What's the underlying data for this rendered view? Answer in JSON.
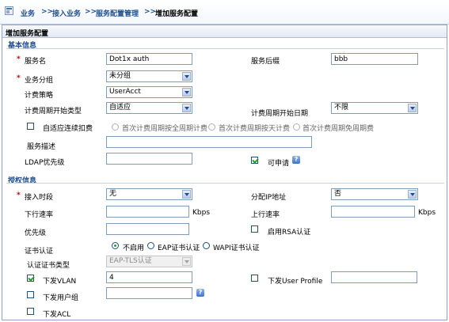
{
  "breadcrumb": {
    "items": [
      "业务",
      "接入业务",
      "服务配置管理",
      "增加服务配置"
    ],
    "separator": ">>"
  },
  "panel_title": "增加服务配置",
  "basic": {
    "title": "基本信息",
    "service_name_label": "服务名",
    "service_name_value": "Dot1x auth",
    "service_suffix_label": "服务后缀",
    "service_suffix_value": "bbb",
    "service_group_label": "业务分组",
    "service_group_value": "未分组",
    "billing_policy_label": "计费策略",
    "billing_policy_value": "UserAcct",
    "billing_cycle_type_label": "计费周期开始类型",
    "billing_cycle_type_value": "自适应",
    "billing_cycle_date_label": "计费周期开始日期",
    "billing_cycle_date_value": "不限",
    "adaptive_deduct_label": "自适应连续扣费",
    "deduct_options": [
      "首次计费周期按全周期计费",
      "首次计费周期按天计费",
      "首次计费周期免周期费"
    ],
    "description_label": "服务描述",
    "description_value": "",
    "ldap_priority_label": "LDAP优先级",
    "ldap_priority_value": "",
    "applicable_label": "可申请",
    "applicable_checked": true
  },
  "auth": {
    "title": "授权信息",
    "access_period_label": "接入时段",
    "access_period_value": "无",
    "assign_ip_label": "分配IP地址",
    "assign_ip_value": "否",
    "downlink_rate_label": "下行速率",
    "downlink_rate_value": "",
    "downlink_unit": "Kbps",
    "uplink_rate_label": "上行速率",
    "uplink_rate_value": "",
    "uplink_unit": "Kbps",
    "priority_label": "优先级",
    "priority_value": "",
    "rsa_label": "启用RSA认证",
    "cert_auth_label": "证书认证",
    "cert_options": [
      "不启用",
      "EAP证书认证",
      "WAPI证书认证"
    ],
    "cert_type_label": "认证证书类型",
    "cert_type_value": "EAP-TLS认证",
    "vlan_label": "下发VLAN",
    "vlan_checked": true,
    "vlan_value": "4",
    "user_profile_label": "下发User Profile",
    "user_profile_value": "",
    "user_group_label": "下发用户组",
    "user_group_value": "",
    "acl_label": "下发ACL"
  },
  "icons": [
    "home-icon",
    "help-icon",
    "chevron-down-icon"
  ],
  "colors": {
    "accent": "#1f4f8f",
    "required": "#cc0000",
    "check": "#21a121"
  }
}
